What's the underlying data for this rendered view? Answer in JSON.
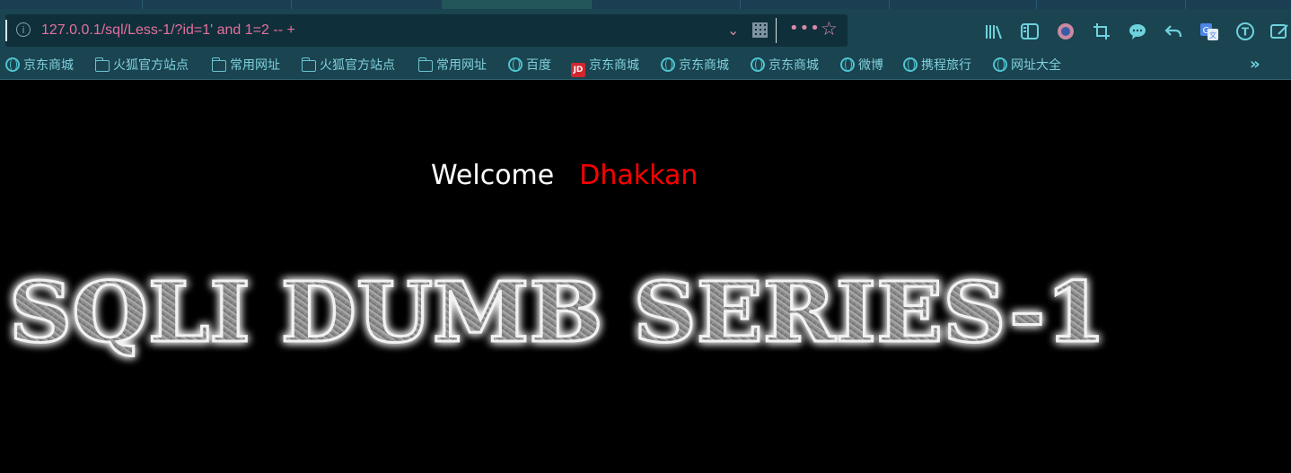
{
  "browser": {
    "url": "127.0.0.1/sql/Less-1/?id=1' and 1=2 -- +",
    "url_info_icon": "info-icon",
    "page_actions_icon": "more-dots-icon",
    "bookmark_star_icon": "star-icon",
    "qr_icon": "qr-code-icon",
    "dropdown_icon": "chevron-down-icon",
    "toolbar_icons": [
      "library-icon",
      "sidebar-icon",
      "avatar-icon",
      "crop-icon",
      "chat-icon",
      "back-arrow-icon",
      "translate-icon",
      "t-circle-icon",
      "edit-icon"
    ]
  },
  "bookmarks": [
    {
      "label": "京东商城",
      "icon": "globe-icon"
    },
    {
      "label": "火狐官方站点",
      "icon": "folder-icon"
    },
    {
      "label": "常用网址",
      "icon": "folder-icon"
    },
    {
      "label": "火狐官方站点",
      "icon": "folder-icon"
    },
    {
      "label": "常用网址",
      "icon": "folder-icon"
    },
    {
      "label": "百度",
      "icon": "globe-icon"
    },
    {
      "label": "京东商城",
      "icon": "jd-icon"
    },
    {
      "label": "京东商城",
      "icon": "globe-icon"
    },
    {
      "label": "京东商城",
      "icon": "globe-icon"
    },
    {
      "label": "微博",
      "icon": "globe-icon"
    },
    {
      "label": "携程旅行",
      "icon": "globe-icon"
    },
    {
      "label": "网址大全",
      "icon": "globe-icon"
    }
  ],
  "bookmarks_overflow_icon": "double-chevron-right-icon",
  "page": {
    "welcome_label": "Welcome",
    "welcome_name": "Dhakkan",
    "banner_text": "SQLI DUMB SERIES-1",
    "colors": {
      "background": "#000000",
      "welcome": "#ffffff",
      "name": "#ff0000"
    }
  }
}
